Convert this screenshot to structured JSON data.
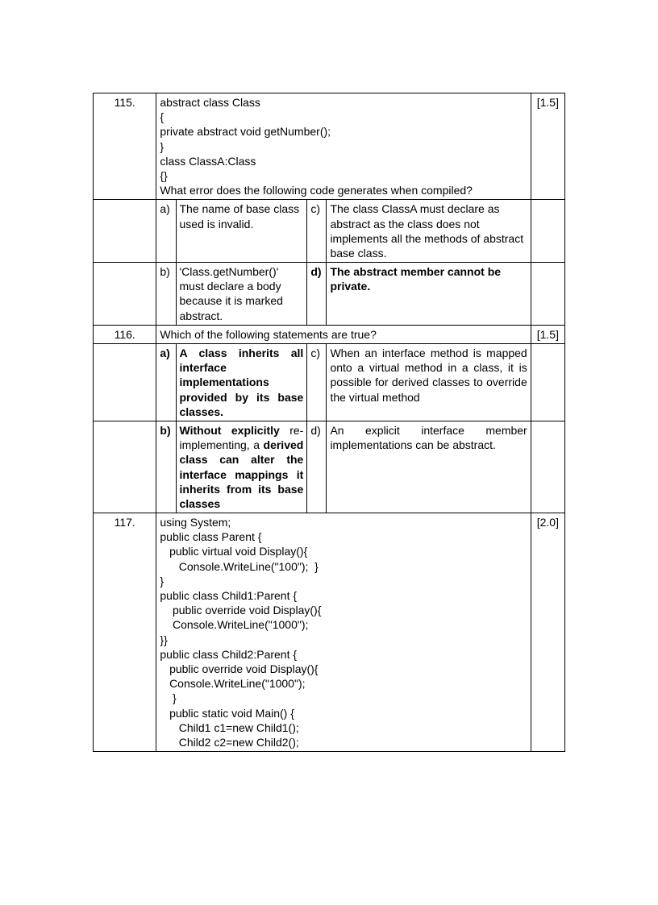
{
  "q115": {
    "number": "115.",
    "marks": "[1.5]",
    "question": "abstract class Class\n{\nprivate abstract void getNumber();\n}\nclass ClassA:Class\n{}\nWhat error does the following code generates when compiled?",
    "a_label": "a)",
    "a_text": "The name of base class used is invalid.",
    "b_label": "b)",
    "b_text": "'Class.getNumber()' must declare a body because it is marked abstract.",
    "c_label": "c)",
    "c_text": "The class ClassA must declare as abstract as the class does not implements all the methods of abstract base class.",
    "d_label": "d)",
    "d_text": "The abstract member cannot be private."
  },
  "q116": {
    "number": "116.",
    "marks": "[1.5]",
    "question": "Which of the following statements are true?",
    "a_label": "a)",
    "a_text": "A class inherits all interface implementations provided by its base classes.",
    "b_label": "b)",
    "b_text_bold1": "Without explicitly",
    "b_text_plain1": " re-implementing, a ",
    "b_text_bold2": "derived class can alter the interface mappings it inherits from its base classes",
    "c_label": "c)",
    "c_text": "When an interface method is mapped onto a virtual method in a class, it is possible for derived classes to override the virtual method",
    "d_label": "d)",
    "d_text": "An explicit interface member implementations can be abstract."
  },
  "q117": {
    "number": "117.",
    "marks": "[2.0]",
    "question": "using System;\npublic class Parent {\n   public virtual void Display(){\n      Console.WriteLine(\"100\");  }\n}\npublic class Child1:Parent {\n    public override void Display(){\n    Console.WriteLine(\"1000\");\n}}\npublic class Child2:Parent {\n   public override void Display(){\n   Console.WriteLine(\"1000\");\n    }\n   public static void Main() {\n      Child1 c1=new Child1();\n      Child2 c2=new Child2();"
  }
}
